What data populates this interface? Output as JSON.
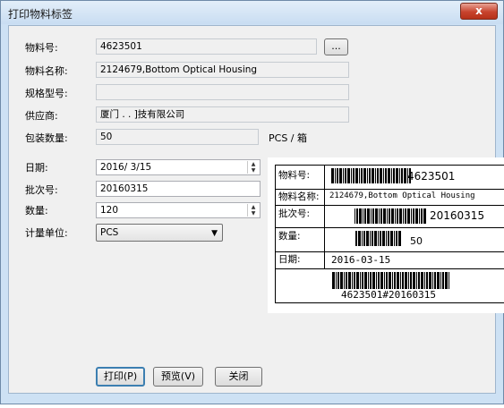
{
  "window": {
    "title": "打印物料标签",
    "close_symbol": "x"
  },
  "form": {
    "material_no": {
      "label": "物料号:",
      "value": "4623501",
      "browse_label": "..."
    },
    "material_name": {
      "label": "物料名称:",
      "value": "2124679,Bottom Optical Housing"
    },
    "spec_model": {
      "label": "规格型号:",
      "value": ""
    },
    "supplier": {
      "label": "供应商:",
      "value": "厦门 .     .  ]技有限公司"
    },
    "pack_qty": {
      "label": "包装数量:",
      "value": "50",
      "unit": "PCS / 箱"
    },
    "date": {
      "label": "日期:",
      "value": "2016/  3/15"
    },
    "batch_no": {
      "label": "批次号:",
      "value": "20160315"
    },
    "quantity": {
      "label": "数量:",
      "value": "120"
    },
    "unit": {
      "label": "计量单位:",
      "value": "PCS"
    }
  },
  "buttons": {
    "print": "打印(P)",
    "preview": "预览(V)",
    "close": "关闭"
  },
  "label_preview": {
    "rows": [
      {
        "head": "物料号:",
        "value": "4623501",
        "barcode": true
      },
      {
        "head": "物料名称:",
        "value": "2124679,Bottom Optical Housing",
        "barcode": false
      },
      {
        "head": "批次号:",
        "value": "20160315",
        "barcode": true
      },
      {
        "head": "数量:",
        "value": "50",
        "barcode": true
      },
      {
        "head": "日期:",
        "value": "2016-03-15",
        "barcode": false
      }
    ],
    "combined_code": "4623501#20160315"
  }
}
